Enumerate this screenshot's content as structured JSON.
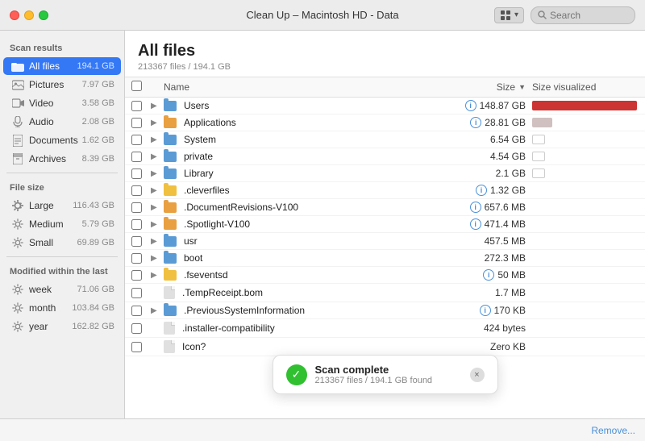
{
  "titlebar": {
    "title": "Clean Up – Macintosh HD - Data",
    "search_placeholder": "Search"
  },
  "sidebar": {
    "scan_results_label": "Scan results",
    "file_size_label": "File size",
    "modified_label": "Modified within the last",
    "items_scan": [
      {
        "id": "all-files",
        "label": "All files",
        "size": "194.1 GB",
        "active": true,
        "icon": "folder"
      },
      {
        "id": "pictures",
        "label": "Pictures",
        "size": "7.97 GB",
        "active": false,
        "icon": "picture"
      },
      {
        "id": "video",
        "label": "Video",
        "size": "3.58 GB",
        "active": false,
        "icon": "video"
      },
      {
        "id": "audio",
        "label": "Audio",
        "size": "2.08 GB",
        "active": false,
        "icon": "audio"
      },
      {
        "id": "documents",
        "label": "Documents",
        "size": "1.62 GB",
        "active": false,
        "icon": "doc"
      },
      {
        "id": "archives",
        "label": "Archives",
        "size": "8.39 GB",
        "active": false,
        "icon": "archive"
      }
    ],
    "items_size": [
      {
        "id": "large",
        "label": "Large",
        "size": "116.43 GB"
      },
      {
        "id": "medium",
        "label": "Medium",
        "size": "5.79 GB"
      },
      {
        "id": "small",
        "label": "Small",
        "size": "69.89 GB"
      }
    ],
    "items_modified": [
      {
        "id": "week",
        "label": "week",
        "size": "71.06 GB"
      },
      {
        "id": "month",
        "label": "month",
        "size": "103.84 GB"
      },
      {
        "id": "year",
        "label": "year",
        "size": "162.82 GB"
      }
    ]
  },
  "content": {
    "title": "All files",
    "subtitle": "213367 files / 194.1 GB",
    "col_name": "Name",
    "col_size": "Size",
    "col_vis": "Size visualized",
    "files": [
      {
        "name": "Users",
        "size": "148.87 GB",
        "indent": 0,
        "type": "folder",
        "color": "blue",
        "has_info": true,
        "has_expand": true,
        "vis_width": 130,
        "vis_color": "red"
      },
      {
        "name": "Applications",
        "size": "28.81 GB",
        "indent": 0,
        "type": "folder",
        "color": "orange",
        "has_info": true,
        "has_expand": true,
        "vis_width": 25,
        "vis_color": "light"
      },
      {
        "name": "System",
        "size": "6.54 GB",
        "indent": 0,
        "type": "folder",
        "color": "blue",
        "has_info": false,
        "has_expand": true,
        "vis_width": 0,
        "vis_color": "outline"
      },
      {
        "name": "private",
        "size": "4.54 GB",
        "indent": 0,
        "type": "folder",
        "color": "blue",
        "has_info": false,
        "has_expand": true,
        "vis_width": 0,
        "vis_color": "outline"
      },
      {
        "name": "Library",
        "size": "2.1 GB",
        "indent": 0,
        "type": "folder",
        "color": "blue",
        "has_info": false,
        "has_expand": true,
        "vis_width": 0,
        "vis_color": "outline"
      },
      {
        "name": ".cleverfiles",
        "size": "1.32 GB",
        "indent": 0,
        "type": "folder",
        "color": "yellow",
        "has_info": true,
        "has_expand": true,
        "vis_width": 0,
        "vis_color": "none"
      },
      {
        "name": ".DocumentRevisions-V100",
        "size": "657.6 MB",
        "indent": 0,
        "type": "folder",
        "color": "orange",
        "has_info": true,
        "has_expand": true,
        "vis_width": 0,
        "vis_color": "none"
      },
      {
        "name": ".Spotlight-V100",
        "size": "471.4 MB",
        "indent": 0,
        "type": "folder",
        "color": "orange",
        "has_info": true,
        "has_expand": true,
        "vis_width": 0,
        "vis_color": "none"
      },
      {
        "name": "usr",
        "size": "457.5 MB",
        "indent": 0,
        "type": "folder",
        "color": "blue",
        "has_info": false,
        "has_expand": true,
        "vis_width": 0,
        "vis_color": "none"
      },
      {
        "name": "boot",
        "size": "272.3 MB",
        "indent": 0,
        "type": "folder",
        "color": "blue",
        "has_info": false,
        "has_expand": true,
        "vis_width": 0,
        "vis_color": "none"
      },
      {
        "name": ".fseventsd",
        "size": "50 MB",
        "indent": 0,
        "type": "folder",
        "color": "yellow",
        "has_info": true,
        "has_expand": true,
        "vis_width": 0,
        "vis_color": "none"
      },
      {
        "name": ".TempReceipt.bom",
        "size": "1.7 MB",
        "indent": 1,
        "type": "file",
        "color": "gray",
        "has_info": false,
        "has_expand": false,
        "vis_width": 0,
        "vis_color": "none"
      },
      {
        "name": ".PreviousSystemInformation",
        "size": "170 KB",
        "indent": 0,
        "type": "folder",
        "color": "blue",
        "has_info": true,
        "has_expand": true,
        "vis_width": 0,
        "vis_color": "none"
      },
      {
        "name": ".installer-compatibility",
        "size": "424 bytes",
        "indent": 0,
        "type": "file",
        "color": "gray",
        "has_info": false,
        "has_expand": false,
        "vis_width": 0,
        "vis_color": "none"
      },
      {
        "name": "Icon?",
        "size": "Zero KB",
        "indent": 0,
        "type": "file",
        "color": "gray",
        "has_info": false,
        "has_expand": false,
        "vis_width": 0,
        "vis_color": "none"
      }
    ]
  },
  "toast": {
    "title": "Scan complete",
    "subtitle": "213367 files / 194.1 GB found",
    "close_label": "×"
  },
  "bottom_bar": {
    "remove_label": "Remove..."
  }
}
